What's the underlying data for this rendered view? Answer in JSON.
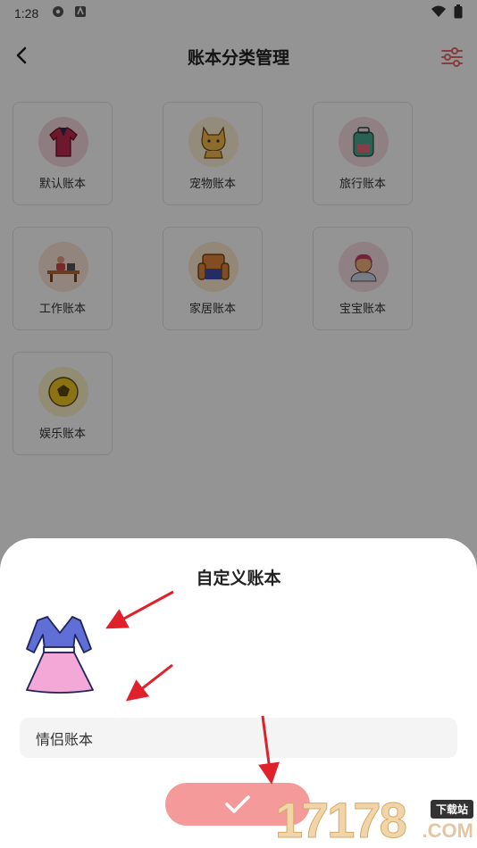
{
  "status_bar": {
    "time": "1:28"
  },
  "header": {
    "title": "账本分类管理"
  },
  "categories": [
    {
      "label": "默认账本",
      "icon": "shirt-icon",
      "bg": "#f3d7dc"
    },
    {
      "label": "宠物账本",
      "icon": "cat-icon",
      "bg": "#fdf2d8"
    },
    {
      "label": "旅行账本",
      "icon": "backpack-icon",
      "bg": "#f6dde3"
    },
    {
      "label": "工作账本",
      "icon": "desk-icon",
      "bg": "#fbe6d7"
    },
    {
      "label": "家居账本",
      "icon": "sofa-icon",
      "bg": "#fde9cf"
    },
    {
      "label": "宝宝账本",
      "icon": "baby-icon",
      "bg": "#f6dde3"
    },
    {
      "label": "娱乐账本",
      "icon": "ball-icon",
      "bg": "#fbf2c8"
    }
  ],
  "sheet": {
    "title": "自定义账本",
    "selected_icon": "dress-icon",
    "name_value": "情侣账本"
  },
  "watermark": {
    "number": "17178",
    "badge": "下载站",
    "domain": ".COM"
  },
  "colors": {
    "accent": "#f49a9a",
    "annotation_arrow": "#e0202a"
  }
}
